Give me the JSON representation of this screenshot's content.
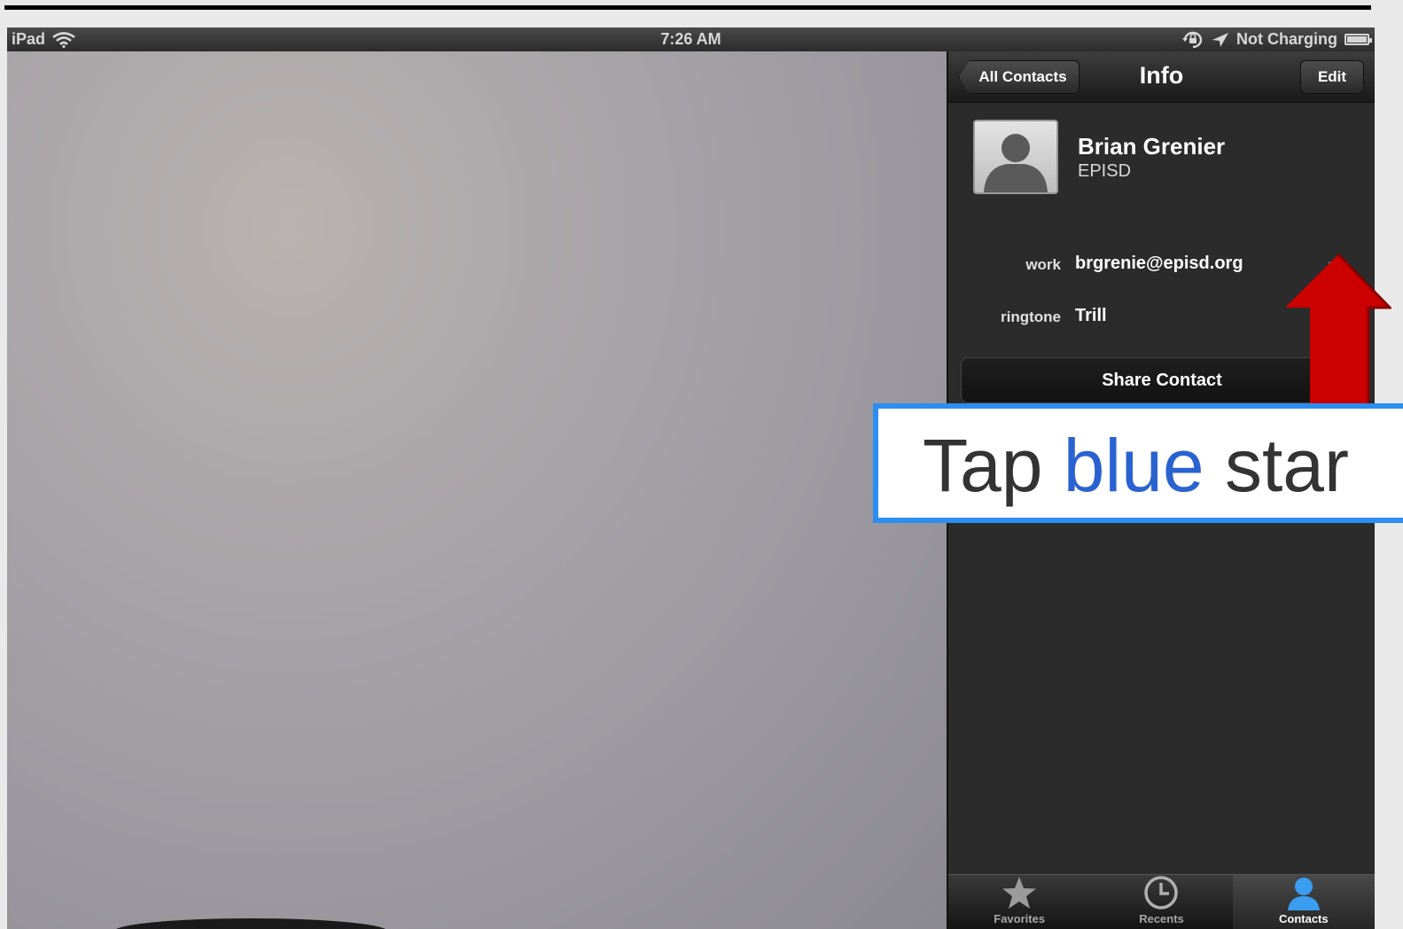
{
  "statusbar": {
    "device": "iPad",
    "time": "7:26 AM",
    "battery_text": "Not Charging"
  },
  "navbar": {
    "back_label": "All Contacts",
    "title": "Info",
    "edit_label": "Edit"
  },
  "contact": {
    "name": "Brian Grenier",
    "organization": "EPISD",
    "fields": [
      {
        "label": "work",
        "value": "brgrenie@episd.org"
      },
      {
        "label": "ringtone",
        "value": "Trill"
      }
    ],
    "favorite_star_color": "#4d9ee9"
  },
  "share_label": "Share Contact",
  "tabs": [
    {
      "label": "Favorites",
      "icon": "star-icon",
      "active": false
    },
    {
      "label": "Recents",
      "icon": "clock-icon",
      "active": false
    },
    {
      "label": "Contacts",
      "icon": "person-icon",
      "active": true
    }
  ],
  "callout": {
    "word1": "Tap",
    "word2": "blue",
    "word3": "star",
    "border_color": "#2b8ef0",
    "highlight_color": "#2a63d0"
  },
  "arrow_color": "#cc0000"
}
